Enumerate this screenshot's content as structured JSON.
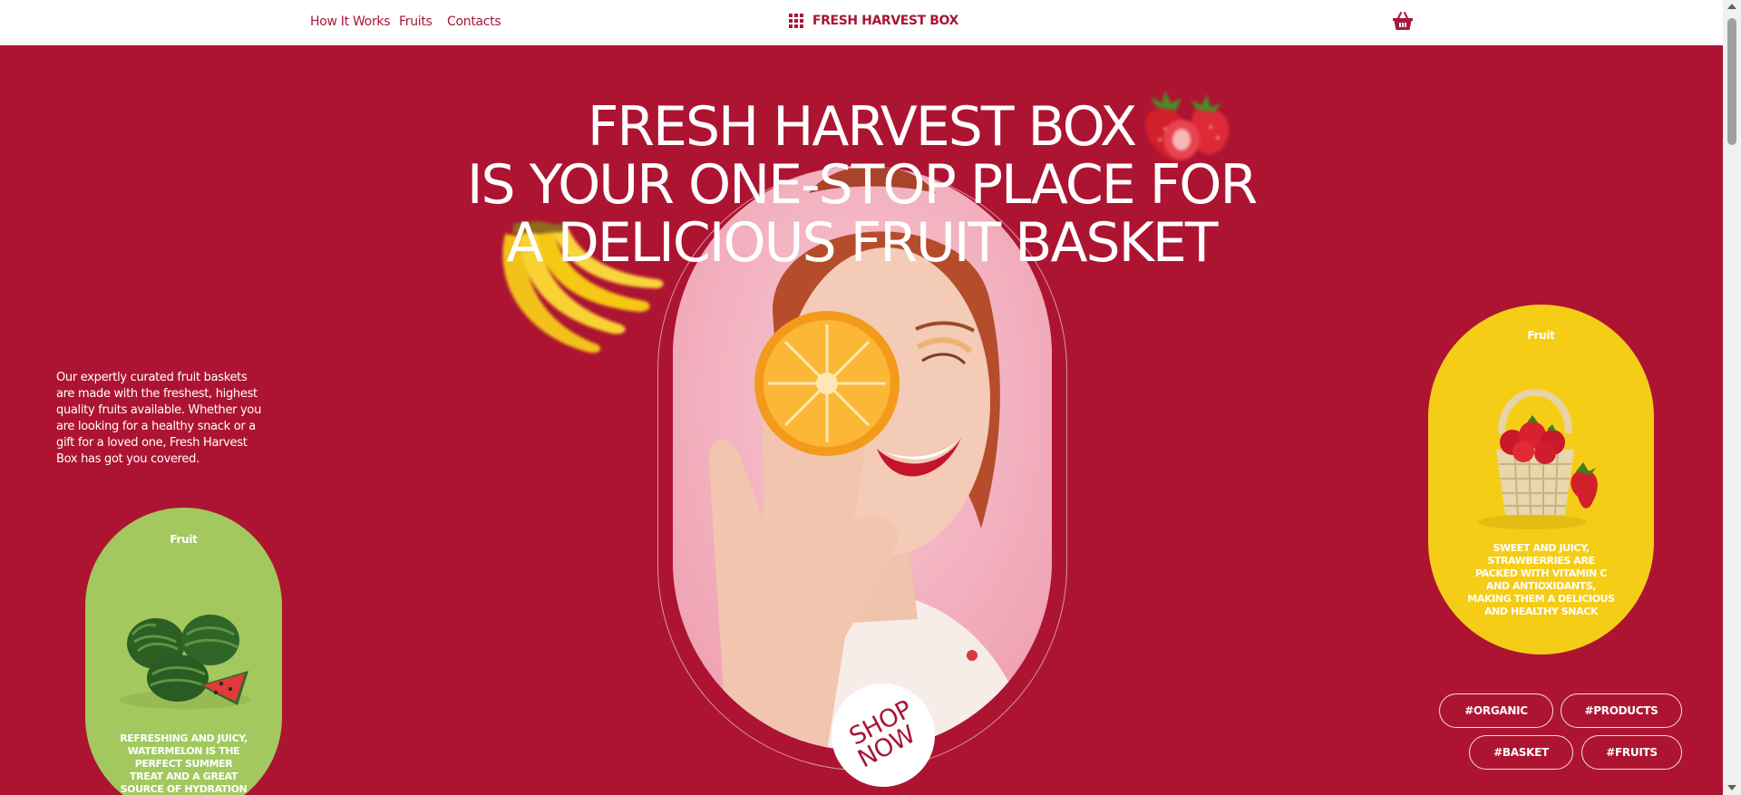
{
  "nav": {
    "links": [
      "How It Works",
      "Fruits",
      "Contacts"
    ],
    "brand": "FRESH HARVEST BOX"
  },
  "hero": {
    "title_lines": [
      "FRESH HARVEST BOX",
      "IS YOUR ONE-STOP PLACE FOR",
      "A DELICIOUS FRUIT BASKET"
    ],
    "intro": "Our expertly curated fruit baskets are made with the freshest, highest quality fruits available. Whether you are looking for a healthy snack or a gift for a loved one, Fresh Harvest Box has got you covered.",
    "cta": [
      "SHOP",
      "NOW"
    ]
  },
  "cards": {
    "green": {
      "label": "Fruit",
      "desc": "REFRESHING AND JUICY, WATERMELON IS THE PERFECT SUMMER TREAT AND A GREAT SOURCE OF HYDRATION",
      "icon": "watermelon-image"
    },
    "yellow": {
      "label": "Fruit",
      "desc": "SWEET AND JUICY, STRAWBERRIES ARE PACKED WITH VITAMIN C AND ANTIOXIDANTS, MAKING THEM A DELICIOUS AND HEALTHY SNACK",
      "icon": "strawberry-basket-image"
    }
  },
  "tags": [
    "#ORGANIC",
    "#PRODUCTS",
    "#BASKET",
    "#FRUITS"
  ],
  "colors": {
    "background": "#ad1432",
    "accent": "#a8163a",
    "green_card": "#a2c85e",
    "yellow_card": "#f5cd17",
    "white": "#ffffff"
  }
}
